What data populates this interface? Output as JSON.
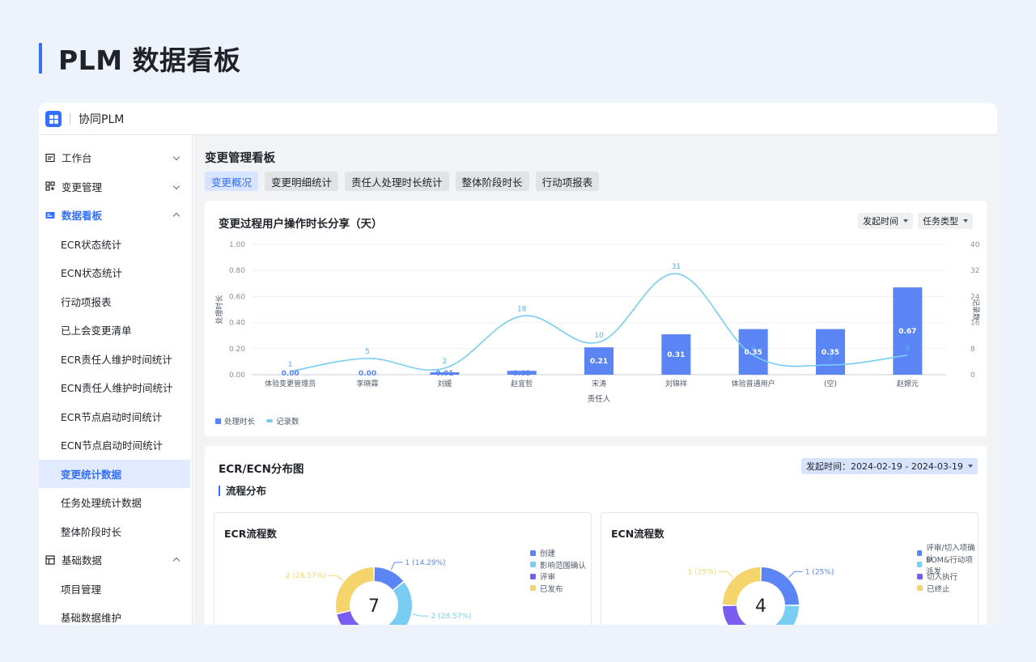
{
  "page": {
    "title": "PLM 数据看板"
  },
  "app": {
    "name": "协同PLM"
  },
  "sidebar": {
    "items": [
      {
        "label": "工作台",
        "type": "group",
        "icon": "calendar-icon",
        "chevron": "down"
      },
      {
        "label": "变更管理",
        "type": "group",
        "icon": "grid-icon",
        "chevron": "down"
      },
      {
        "label": "数据看板",
        "type": "group",
        "icon": "dashboard-icon",
        "chevron": "up",
        "active": true
      },
      {
        "label": "ECR状态统计",
        "type": "sub"
      },
      {
        "label": "ECN状态统计",
        "type": "sub"
      },
      {
        "label": "行动项报表",
        "type": "sub"
      },
      {
        "label": "已上会变更清单",
        "type": "sub"
      },
      {
        "label": "ECR责任人维护时间统计",
        "type": "sub"
      },
      {
        "label": "ECN责任人维护时间统计",
        "type": "sub"
      },
      {
        "label": "ECR节点启动时间统计",
        "type": "sub"
      },
      {
        "label": "ECN节点启动时间统计",
        "type": "sub"
      },
      {
        "label": "变更统计数据",
        "type": "sub",
        "active": true
      },
      {
        "label": "任务处理统计数据",
        "type": "sub"
      },
      {
        "label": "整体阶段时长",
        "type": "sub"
      },
      {
        "label": "基础数据",
        "type": "group",
        "icon": "table-icon",
        "chevron": "up"
      },
      {
        "label": "项目管理",
        "type": "sub"
      },
      {
        "label": "基础数据维护",
        "type": "sub"
      }
    ]
  },
  "main": {
    "title": "变更管理看板",
    "tabs": [
      {
        "label": "变更概况",
        "active": true
      },
      {
        "label": "变更明细统计"
      },
      {
        "label": "责任人处理时长统计"
      },
      {
        "label": "整体阶段时长"
      },
      {
        "label": "行动项报表"
      }
    ]
  },
  "card1": {
    "title": "变更过程用户操作时长分享（天）",
    "filters": [
      "发起时间",
      "任务类型"
    ]
  },
  "chart_data": {
    "type": "bar",
    "title": "变更过程用户操作时长分享（天）",
    "xlabel": "责任人",
    "ylabel": "处理时长",
    "y2label": "记录数",
    "categories": [
      "体验变更管理员",
      "李晓霖",
      "刘媛",
      "赵宜哲",
      "宋涛",
      "刘锦祥",
      "体验普通用户",
      "(空)",
      "赵嫦元"
    ],
    "series": [
      {
        "name": "处理时长",
        "type": "bar",
        "axis": "left",
        "values": [
          0.0,
          0.0,
          0.01,
          0.03,
          0.21,
          0.31,
          0.35,
          0.35,
          0.67
        ],
        "labels": [
          "0.00",
          "0.00",
          "0.01",
          "0.03",
          "0.21",
          "0.31",
          "0.35",
          "0.35",
          "0.67"
        ],
        "color": "#5b85f5"
      },
      {
        "name": "记录数",
        "type": "line",
        "axis": "right",
        "values": [
          1,
          5,
          2,
          18,
          10,
          31,
          6,
          3,
          6
        ],
        "color": "#79cdf3"
      }
    ],
    "ylim": [
      0,
      1
    ],
    "yticks": [
      "0.00",
      "0.20",
      "0.40",
      "0.60",
      "0.80",
      "1.00"
    ],
    "y2lim": [
      0,
      40
    ],
    "y2ticks": [
      "0",
      "8",
      "16",
      "24",
      "32",
      "40"
    ],
    "legend": "bottom-left",
    "grid": true
  },
  "card2": {
    "title": "ECR/ECN分布图",
    "date_filter": "发起时间：2024-02-19 - 2024-03-19",
    "section": "流程分布",
    "ecr": {
      "title": "ECR流程数",
      "total": "7",
      "legend": [
        {
          "label": "创建",
          "color": "#5b85f5"
        },
        {
          "label": "影响范围确认",
          "color": "#79cdf3"
        },
        {
          "label": "评审",
          "color": "#7b5cf0"
        },
        {
          "label": "已发布",
          "color": "#f5d46b"
        }
      ],
      "slices": [
        1,
        2,
        2,
        2
      ],
      "visible_labels": [
        {
          "text": "1 (14.29%)",
          "color": "#5b85f5"
        },
        {
          "text": "2 (28.57%)",
          "color": "#79cdf3"
        },
        {
          "text": "2 (28.57%)",
          "color": "#f5d46b"
        }
      ]
    },
    "ecn": {
      "title": "ECN流程数",
      "total": "4",
      "legend": [
        {
          "label": "评审/切入项确认",
          "color": "#5b85f5"
        },
        {
          "label": "BOM&行动项派发",
          "color": "#79cdf3"
        },
        {
          "label": "切入执行",
          "color": "#7b5cf0"
        },
        {
          "label": "已终止",
          "color": "#f5d46b"
        }
      ],
      "slices": [
        1,
        1,
        1,
        1
      ],
      "visible_labels": [
        {
          "text": "1 (25%)",
          "color": "#5b85f5"
        },
        {
          "text": "1 (25%)",
          "color": "#f5d46b"
        }
      ]
    }
  }
}
